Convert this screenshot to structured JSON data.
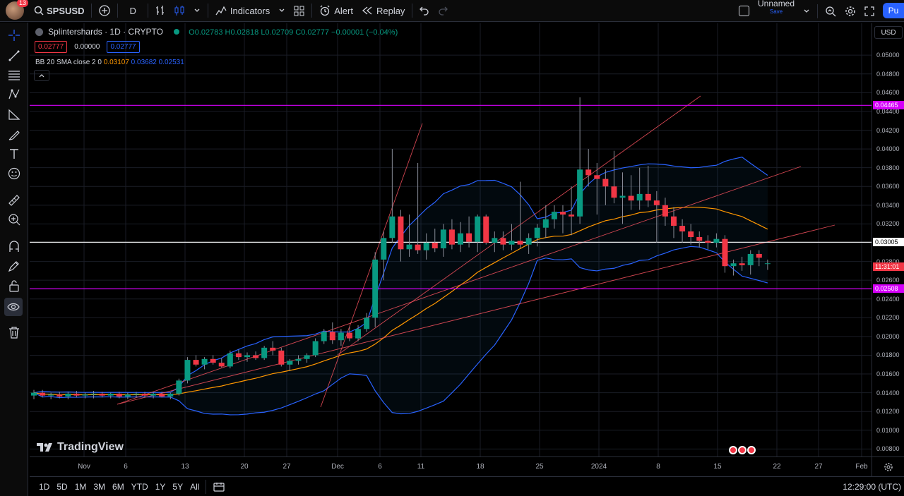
{
  "topbar": {
    "avatar_badge": "13",
    "symbol": "SPSUSD",
    "interval": "D",
    "indicators_label": "Indicators",
    "alert_label": "Alert",
    "replay_label": "Replay",
    "layout_name": "Unnamed",
    "layout_save": "Save",
    "publish_label": "Pu"
  },
  "legend": {
    "title": "Splintershards · 1D · CRYPTO",
    "ohlc": {
      "o": "O0.02783",
      "h": "H0.02818",
      "l": "L0.02709",
      "c": "C0.02777",
      "chg": "−0.00001 (−0.04%)"
    },
    "bid": "0.02777",
    "spread": "0.00000",
    "ask": "0.02777",
    "bb_name": "BB 20 SMA close 2 0",
    "bb_basis": "0.03107",
    "bb_upper": "0.03682",
    "bb_lower": "0.02531"
  },
  "currency": "USD",
  "watermark": "TradingView",
  "price_ticks": [
    "0.05000",
    "0.04800",
    "0.04600",
    "0.04400",
    "0.04200",
    "0.04000",
    "0.03800",
    "0.03600",
    "0.03400",
    "0.03200",
    "0.02800",
    "0.02600",
    "0.02400",
    "0.02200",
    "0.02000",
    "0.01800",
    "0.01600",
    "0.01400",
    "0.01200",
    "0.01000",
    "0.00800"
  ],
  "price_tags": {
    "upper_line": "0.04465",
    "mid_line": "0.03005",
    "countdown": "11:31:01",
    "lower_line": "0.02508"
  },
  "time_ticks": [
    "Nov",
    "6",
    "13",
    "20",
    "27",
    "Dec",
    "6",
    "11",
    "18",
    "25",
    "2024",
    "8",
    "15",
    "22",
    "27",
    "Feb"
  ],
  "ranges": [
    "1D",
    "5D",
    "1M",
    "3M",
    "6M",
    "YTD",
    "1Y",
    "5Y",
    "All"
  ],
  "clock": "12:29:00 (UTC)",
  "colors": {
    "up": "#089981",
    "down": "#f23645",
    "bb": "#2962ff",
    "basis": "#ff9800",
    "magenta": "#d500f9",
    "trend": "#f7525f"
  },
  "chart_data": {
    "type": "candlestick",
    "ylim": [
      0.0072,
      0.0534
    ],
    "candles": [
      {
        "o": 0.0137,
        "h": 0.0143,
        "l": 0.0133,
        "c": 0.014
      },
      {
        "o": 0.014,
        "h": 0.0143,
        "l": 0.0135,
        "c": 0.0137
      },
      {
        "o": 0.0137,
        "h": 0.014,
        "l": 0.0133,
        "c": 0.0138
      },
      {
        "o": 0.0138,
        "h": 0.0141,
        "l": 0.0134,
        "c": 0.0136
      },
      {
        "o": 0.0136,
        "h": 0.0141,
        "l": 0.0133,
        "c": 0.0139
      },
      {
        "o": 0.0139,
        "h": 0.0142,
        "l": 0.0135,
        "c": 0.0137
      },
      {
        "o": 0.0137,
        "h": 0.014,
        "l": 0.0134,
        "c": 0.0138
      },
      {
        "o": 0.0138,
        "h": 0.0142,
        "l": 0.0134,
        "c": 0.0139
      },
      {
        "o": 0.0139,
        "h": 0.0141,
        "l": 0.0135,
        "c": 0.0137
      },
      {
        "o": 0.0137,
        "h": 0.014,
        "l": 0.0134,
        "c": 0.0139
      },
      {
        "o": 0.0139,
        "h": 0.0141,
        "l": 0.0134,
        "c": 0.0136
      },
      {
        "o": 0.0136,
        "h": 0.014,
        "l": 0.0133,
        "c": 0.0138
      },
      {
        "o": 0.0138,
        "h": 0.0141,
        "l": 0.0135,
        "c": 0.0139
      },
      {
        "o": 0.0139,
        "h": 0.0141,
        "l": 0.0135,
        "c": 0.0137
      },
      {
        "o": 0.0137,
        "h": 0.0141,
        "l": 0.0134,
        "c": 0.0139
      },
      {
        "o": 0.0139,
        "h": 0.0141,
        "l": 0.0135,
        "c": 0.0136
      },
      {
        "o": 0.0136,
        "h": 0.014,
        "l": 0.0133,
        "c": 0.0139
      },
      {
        "o": 0.0139,
        "h": 0.0155,
        "l": 0.0137,
        "c": 0.0153
      },
      {
        "o": 0.0153,
        "h": 0.0178,
        "l": 0.015,
        "c": 0.0175
      },
      {
        "o": 0.0175,
        "h": 0.018,
        "l": 0.0168,
        "c": 0.017
      },
      {
        "o": 0.017,
        "h": 0.0178,
        "l": 0.0165,
        "c": 0.0176
      },
      {
        "o": 0.0176,
        "h": 0.018,
        "l": 0.017,
        "c": 0.0172
      },
      {
        "o": 0.0172,
        "h": 0.0177,
        "l": 0.0167,
        "c": 0.0168
      },
      {
        "o": 0.0168,
        "h": 0.0185,
        "l": 0.0166,
        "c": 0.0182
      },
      {
        "o": 0.0182,
        "h": 0.0186,
        "l": 0.0175,
        "c": 0.0178
      },
      {
        "o": 0.0178,
        "h": 0.0183,
        "l": 0.0173,
        "c": 0.018
      },
      {
        "o": 0.018,
        "h": 0.0184,
        "l": 0.0175,
        "c": 0.0177
      },
      {
        "o": 0.0177,
        "h": 0.019,
        "l": 0.0175,
        "c": 0.0188
      },
      {
        "o": 0.0188,
        "h": 0.0195,
        "l": 0.018,
        "c": 0.0185
      },
      {
        "o": 0.0185,
        "h": 0.0188,
        "l": 0.0168,
        "c": 0.017
      },
      {
        "o": 0.017,
        "h": 0.0176,
        "l": 0.0163,
        "c": 0.0174
      },
      {
        "o": 0.0174,
        "h": 0.018,
        "l": 0.017,
        "c": 0.0176
      },
      {
        "o": 0.0176,
        "h": 0.0182,
        "l": 0.0172,
        "c": 0.018
      },
      {
        "o": 0.018,
        "h": 0.0198,
        "l": 0.0178,
        "c": 0.0195
      },
      {
        "o": 0.0195,
        "h": 0.0208,
        "l": 0.0192,
        "c": 0.0205
      },
      {
        "o": 0.0205,
        "h": 0.0215,
        "l": 0.0192,
        "c": 0.0196
      },
      {
        "o": 0.0196,
        "h": 0.0208,
        "l": 0.019,
        "c": 0.0204
      },
      {
        "o": 0.0204,
        "h": 0.021,
        "l": 0.0195,
        "c": 0.0198
      },
      {
        "o": 0.0198,
        "h": 0.0212,
        "l": 0.0195,
        "c": 0.0208
      },
      {
        "o": 0.0208,
        "h": 0.0225,
        "l": 0.0205,
        "c": 0.022
      },
      {
        "o": 0.022,
        "h": 0.029,
        "l": 0.021,
        "c": 0.0282
      },
      {
        "o": 0.0282,
        "h": 0.0312,
        "l": 0.026,
        "c": 0.0305
      },
      {
        "o": 0.0305,
        "h": 0.04,
        "l": 0.03,
        "c": 0.0328
      },
      {
        "o": 0.0328,
        "h": 0.0335,
        "l": 0.028,
        "c": 0.0293
      },
      {
        "o": 0.0293,
        "h": 0.033,
        "l": 0.0285,
        "c": 0.0298
      },
      {
        "o": 0.0298,
        "h": 0.0385,
        "l": 0.0288,
        "c": 0.0292
      },
      {
        "o": 0.0292,
        "h": 0.031,
        "l": 0.0282,
        "c": 0.03
      },
      {
        "o": 0.03,
        "h": 0.0315,
        "l": 0.029,
        "c": 0.0294
      },
      {
        "o": 0.0294,
        "h": 0.032,
        "l": 0.0285,
        "c": 0.0314
      },
      {
        "o": 0.0314,
        "h": 0.0325,
        "l": 0.0293,
        "c": 0.0298
      },
      {
        "o": 0.0298,
        "h": 0.0322,
        "l": 0.029,
        "c": 0.031
      },
      {
        "o": 0.031,
        "h": 0.0328,
        "l": 0.0295,
        "c": 0.0301
      },
      {
        "o": 0.0301,
        "h": 0.033,
        "l": 0.029,
        "c": 0.0328
      },
      {
        "o": 0.0328,
        "h": 0.033,
        "l": 0.0298,
        "c": 0.03
      },
      {
        "o": 0.03,
        "h": 0.0312,
        "l": 0.029,
        "c": 0.0305
      },
      {
        "o": 0.0305,
        "h": 0.0312,
        "l": 0.0292,
        "c": 0.0298
      },
      {
        "o": 0.0298,
        "h": 0.032,
        "l": 0.0292,
        "c": 0.0302
      },
      {
        "o": 0.0302,
        "h": 0.0365,
        "l": 0.0294,
        "c": 0.0298
      },
      {
        "o": 0.0298,
        "h": 0.031,
        "l": 0.0288,
        "c": 0.0305
      },
      {
        "o": 0.0305,
        "h": 0.032,
        "l": 0.0296,
        "c": 0.0316
      },
      {
        "o": 0.0316,
        "h": 0.034,
        "l": 0.0305,
        "c": 0.0325
      },
      {
        "o": 0.0325,
        "h": 0.034,
        "l": 0.0315,
        "c": 0.0333
      },
      {
        "o": 0.0333,
        "h": 0.034,
        "l": 0.031,
        "c": 0.033
      },
      {
        "o": 0.033,
        "h": 0.036,
        "l": 0.0308,
        "c": 0.0328
      },
      {
        "o": 0.0328,
        "h": 0.0455,
        "l": 0.032,
        "c": 0.0378
      },
      {
        "o": 0.0378,
        "h": 0.04,
        "l": 0.036,
        "c": 0.0372
      },
      {
        "o": 0.0372,
        "h": 0.0385,
        "l": 0.033,
        "c": 0.0368
      },
      {
        "o": 0.0368,
        "h": 0.0378,
        "l": 0.034,
        "c": 0.036
      },
      {
        "o": 0.036,
        "h": 0.0398,
        "l": 0.0342,
        "c": 0.0348
      },
      {
        "o": 0.0348,
        "h": 0.0375,
        "l": 0.032,
        "c": 0.035
      },
      {
        "o": 0.035,
        "h": 0.0372,
        "l": 0.0335,
        "c": 0.0345
      },
      {
        "o": 0.0345,
        "h": 0.038,
        "l": 0.0335,
        "c": 0.0352
      },
      {
        "o": 0.0352,
        "h": 0.0382,
        "l": 0.0338,
        "c": 0.0345
      },
      {
        "o": 0.0345,
        "h": 0.0355,
        "l": 0.03,
        "c": 0.034
      },
      {
        "o": 0.034,
        "h": 0.0348,
        "l": 0.0318,
        "c": 0.0328
      },
      {
        "o": 0.0328,
        "h": 0.0338,
        "l": 0.0305,
        "c": 0.0318
      },
      {
        "o": 0.0318,
        "h": 0.0325,
        "l": 0.03,
        "c": 0.0312
      },
      {
        "o": 0.0312,
        "h": 0.032,
        "l": 0.0298,
        "c": 0.0306
      },
      {
        "o": 0.0306,
        "h": 0.0312,
        "l": 0.0295,
        "c": 0.0302
      },
      {
        "o": 0.0302,
        "h": 0.0308,
        "l": 0.0293,
        "c": 0.03
      },
      {
        "o": 0.03,
        "h": 0.031,
        "l": 0.0295,
        "c": 0.0304
      },
      {
        "o": 0.0304,
        "h": 0.0308,
        "l": 0.0268,
        "c": 0.0275
      },
      {
        "o": 0.0275,
        "h": 0.0282,
        "l": 0.0265,
        "c": 0.0278
      },
      {
        "o": 0.0278,
        "h": 0.0285,
        "l": 0.027,
        "c": 0.0276
      },
      {
        "o": 0.0276,
        "h": 0.0292,
        "l": 0.0266,
        "c": 0.0288
      },
      {
        "o": 0.0288,
        "h": 0.0292,
        "l": 0.0275,
        "c": 0.0284
      },
      {
        "o": 0.0278,
        "h": 0.0282,
        "l": 0.0271,
        "c": 0.0278
      }
    ]
  }
}
